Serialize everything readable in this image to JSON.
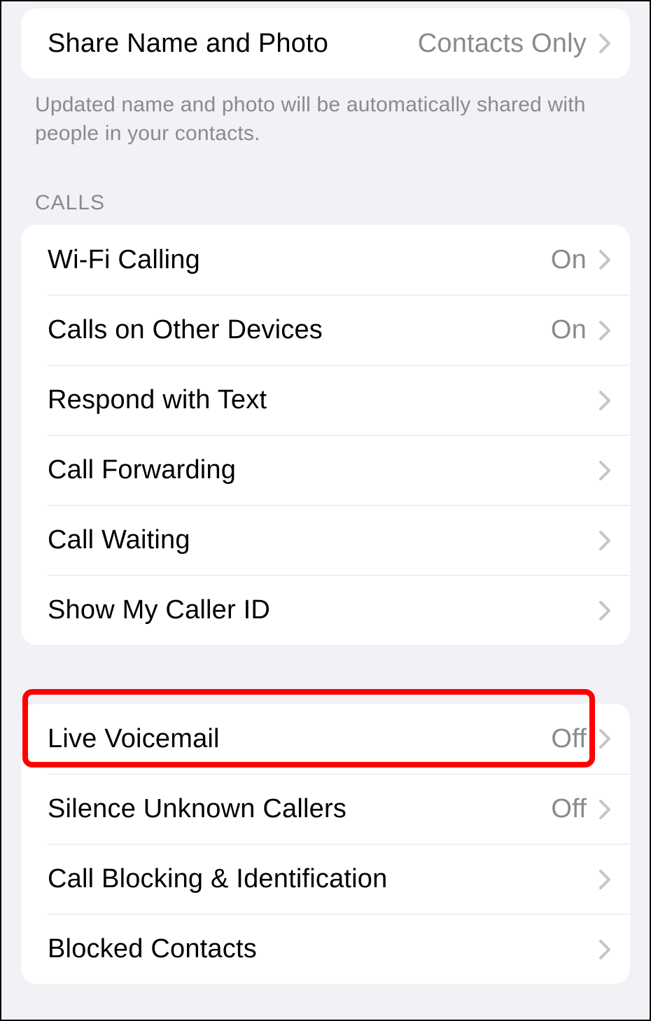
{
  "share_section": {
    "share_row": {
      "label": "Share Name and Photo",
      "value": "Contacts Only"
    },
    "footer": "Updated name and photo will be automatically shared with people in your contacts."
  },
  "calls_section": {
    "header": "CALLS",
    "rows": [
      {
        "label": "Wi-Fi Calling",
        "value": "On"
      },
      {
        "label": "Calls on Other Devices",
        "value": "On"
      },
      {
        "label": "Respond with Text",
        "value": ""
      },
      {
        "label": "Call Forwarding",
        "value": ""
      },
      {
        "label": "Call Waiting",
        "value": ""
      },
      {
        "label": "Show My Caller ID",
        "value": ""
      }
    ]
  },
  "calls_section_fix": {
    "rows": [
      {
        "label": "Wi-Fi Calling",
        "value": "On"
      },
      {
        "label": "Calls on Other Devices",
        "value": "On"
      },
      {
        "label": "Respond with Text",
        "value": ""
      },
      {
        "label": "Call Forwarding",
        "value": ""
      },
      {
        "label": "Call Waiting",
        "value": ""
      },
      {
        "label": "Show My Caller ID",
        "value": ""
      }
    ]
  },
  "voicemail_section": {
    "rows": [
      {
        "label": "Live Voicemail",
        "value": "Off"
      },
      {
        "label": "Silence Unknown Callers",
        "value": "Off"
      },
      {
        "label": "Call Blocking & Identification",
        "value": ""
      },
      {
        "label": "Blocked Contacts",
        "value": ""
      }
    ]
  }
}
